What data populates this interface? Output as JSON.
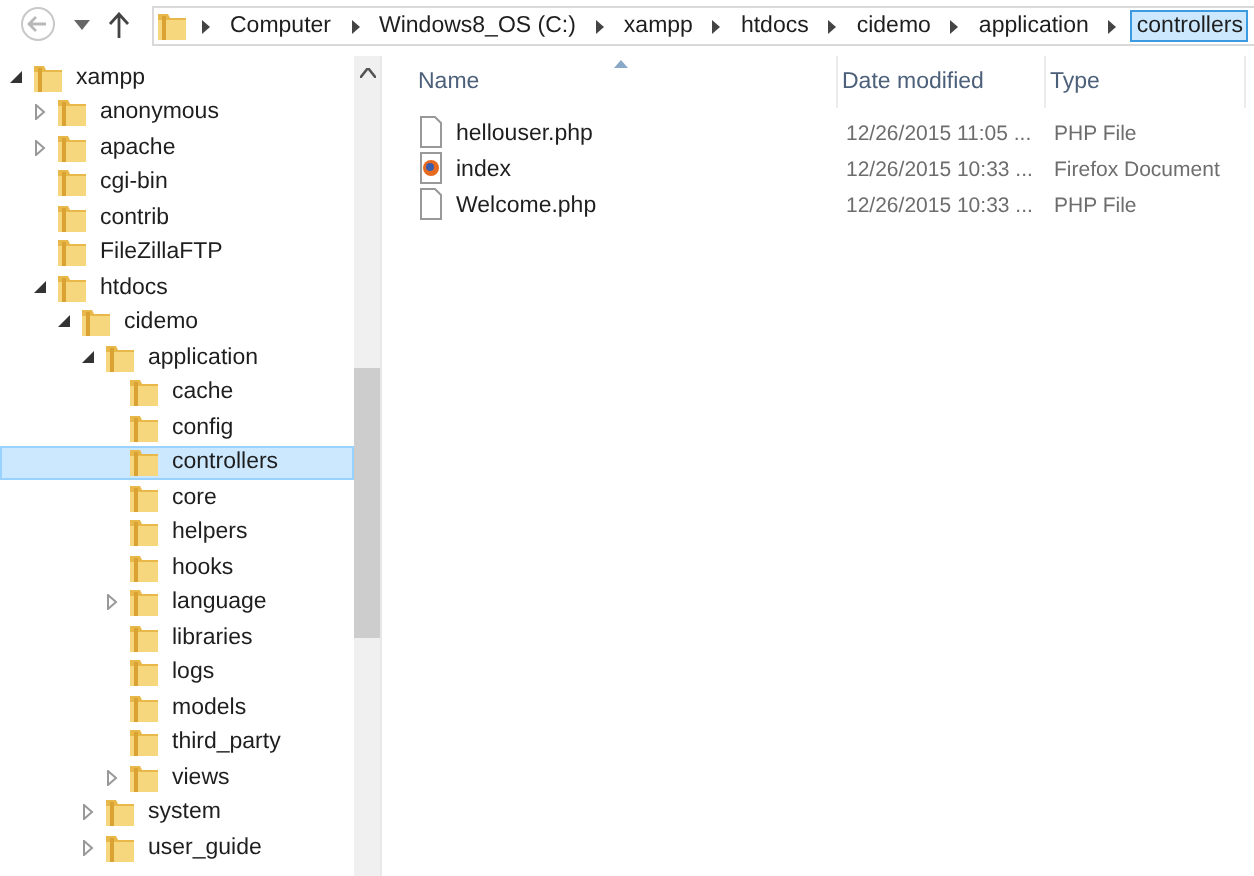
{
  "address_bar": {
    "crumbs": [
      {
        "label": "Computer",
        "selected": false
      },
      {
        "label": "Windows8_OS (C:)",
        "selected": false
      },
      {
        "label": "xampp",
        "selected": false
      },
      {
        "label": "htdocs",
        "selected": false
      },
      {
        "label": "cidemo",
        "selected": false
      },
      {
        "label": "application",
        "selected": false
      },
      {
        "label": "controllers",
        "selected": true
      }
    ]
  },
  "tree": [
    {
      "label": "xampp",
      "kind": "branch",
      "expanded": true,
      "selected": false,
      "children": [
        {
          "label": "anonymous",
          "kind": "branch",
          "expanded": false,
          "selected": false
        },
        {
          "label": "apache",
          "kind": "branch",
          "expanded": false,
          "selected": false
        },
        {
          "label": "cgi-bin",
          "kind": "leaf",
          "selected": false
        },
        {
          "label": "contrib",
          "kind": "leaf",
          "selected": false
        },
        {
          "label": "FileZillaFTP",
          "kind": "leaf",
          "selected": false
        },
        {
          "label": "htdocs",
          "kind": "branch",
          "expanded": true,
          "selected": false,
          "children": [
            {
              "label": "cidemo",
              "kind": "branch",
              "expanded": true,
              "selected": false,
              "children": [
                {
                  "label": "application",
                  "kind": "branch",
                  "expanded": true,
                  "selected": false,
                  "children": [
                    {
                      "label": "cache",
                      "kind": "leaf",
                      "selected": false
                    },
                    {
                      "label": "config",
                      "kind": "leaf",
                      "selected": false
                    },
                    {
                      "label": "controllers",
                      "kind": "leaf",
                      "selected": true
                    },
                    {
                      "label": "core",
                      "kind": "leaf",
                      "selected": false
                    },
                    {
                      "label": "helpers",
                      "kind": "leaf",
                      "selected": false
                    },
                    {
                      "label": "hooks",
                      "kind": "leaf",
                      "selected": false
                    },
                    {
                      "label": "language",
                      "kind": "branch",
                      "expanded": false,
                      "selected": false
                    },
                    {
                      "label": "libraries",
                      "kind": "leaf",
                      "selected": false
                    },
                    {
                      "label": "logs",
                      "kind": "leaf",
                      "selected": false
                    },
                    {
                      "label": "models",
                      "kind": "leaf",
                      "selected": false
                    },
                    {
                      "label": "third_party",
                      "kind": "leaf",
                      "selected": false
                    },
                    {
                      "label": "views",
                      "kind": "branch",
                      "expanded": false,
                      "selected": false
                    }
                  ]
                },
                {
                  "label": "system",
                  "kind": "branch",
                  "expanded": false,
                  "selected": false
                },
                {
                  "label": "user_guide",
                  "kind": "branch",
                  "expanded": false,
                  "selected": false
                }
              ]
            }
          ]
        }
      ]
    }
  ],
  "file_list": {
    "columns": [
      {
        "label": "Name",
        "sorted": true
      },
      {
        "label": "Date modified",
        "sorted": false
      },
      {
        "label": "Type",
        "sorted": false
      }
    ],
    "rows": [
      {
        "kind": "php",
        "name": "hellouser.php",
        "date": "12/26/2015 11:05 ...",
        "type": "PHP File"
      },
      {
        "kind": "firefox",
        "name": "index",
        "date": "12/26/2015 10:33 ...",
        "type": "Firefox Document"
      },
      {
        "kind": "php",
        "name": "Welcome.php",
        "date": "12/26/2015 10:33 ...",
        "type": "PHP File"
      }
    ]
  }
}
